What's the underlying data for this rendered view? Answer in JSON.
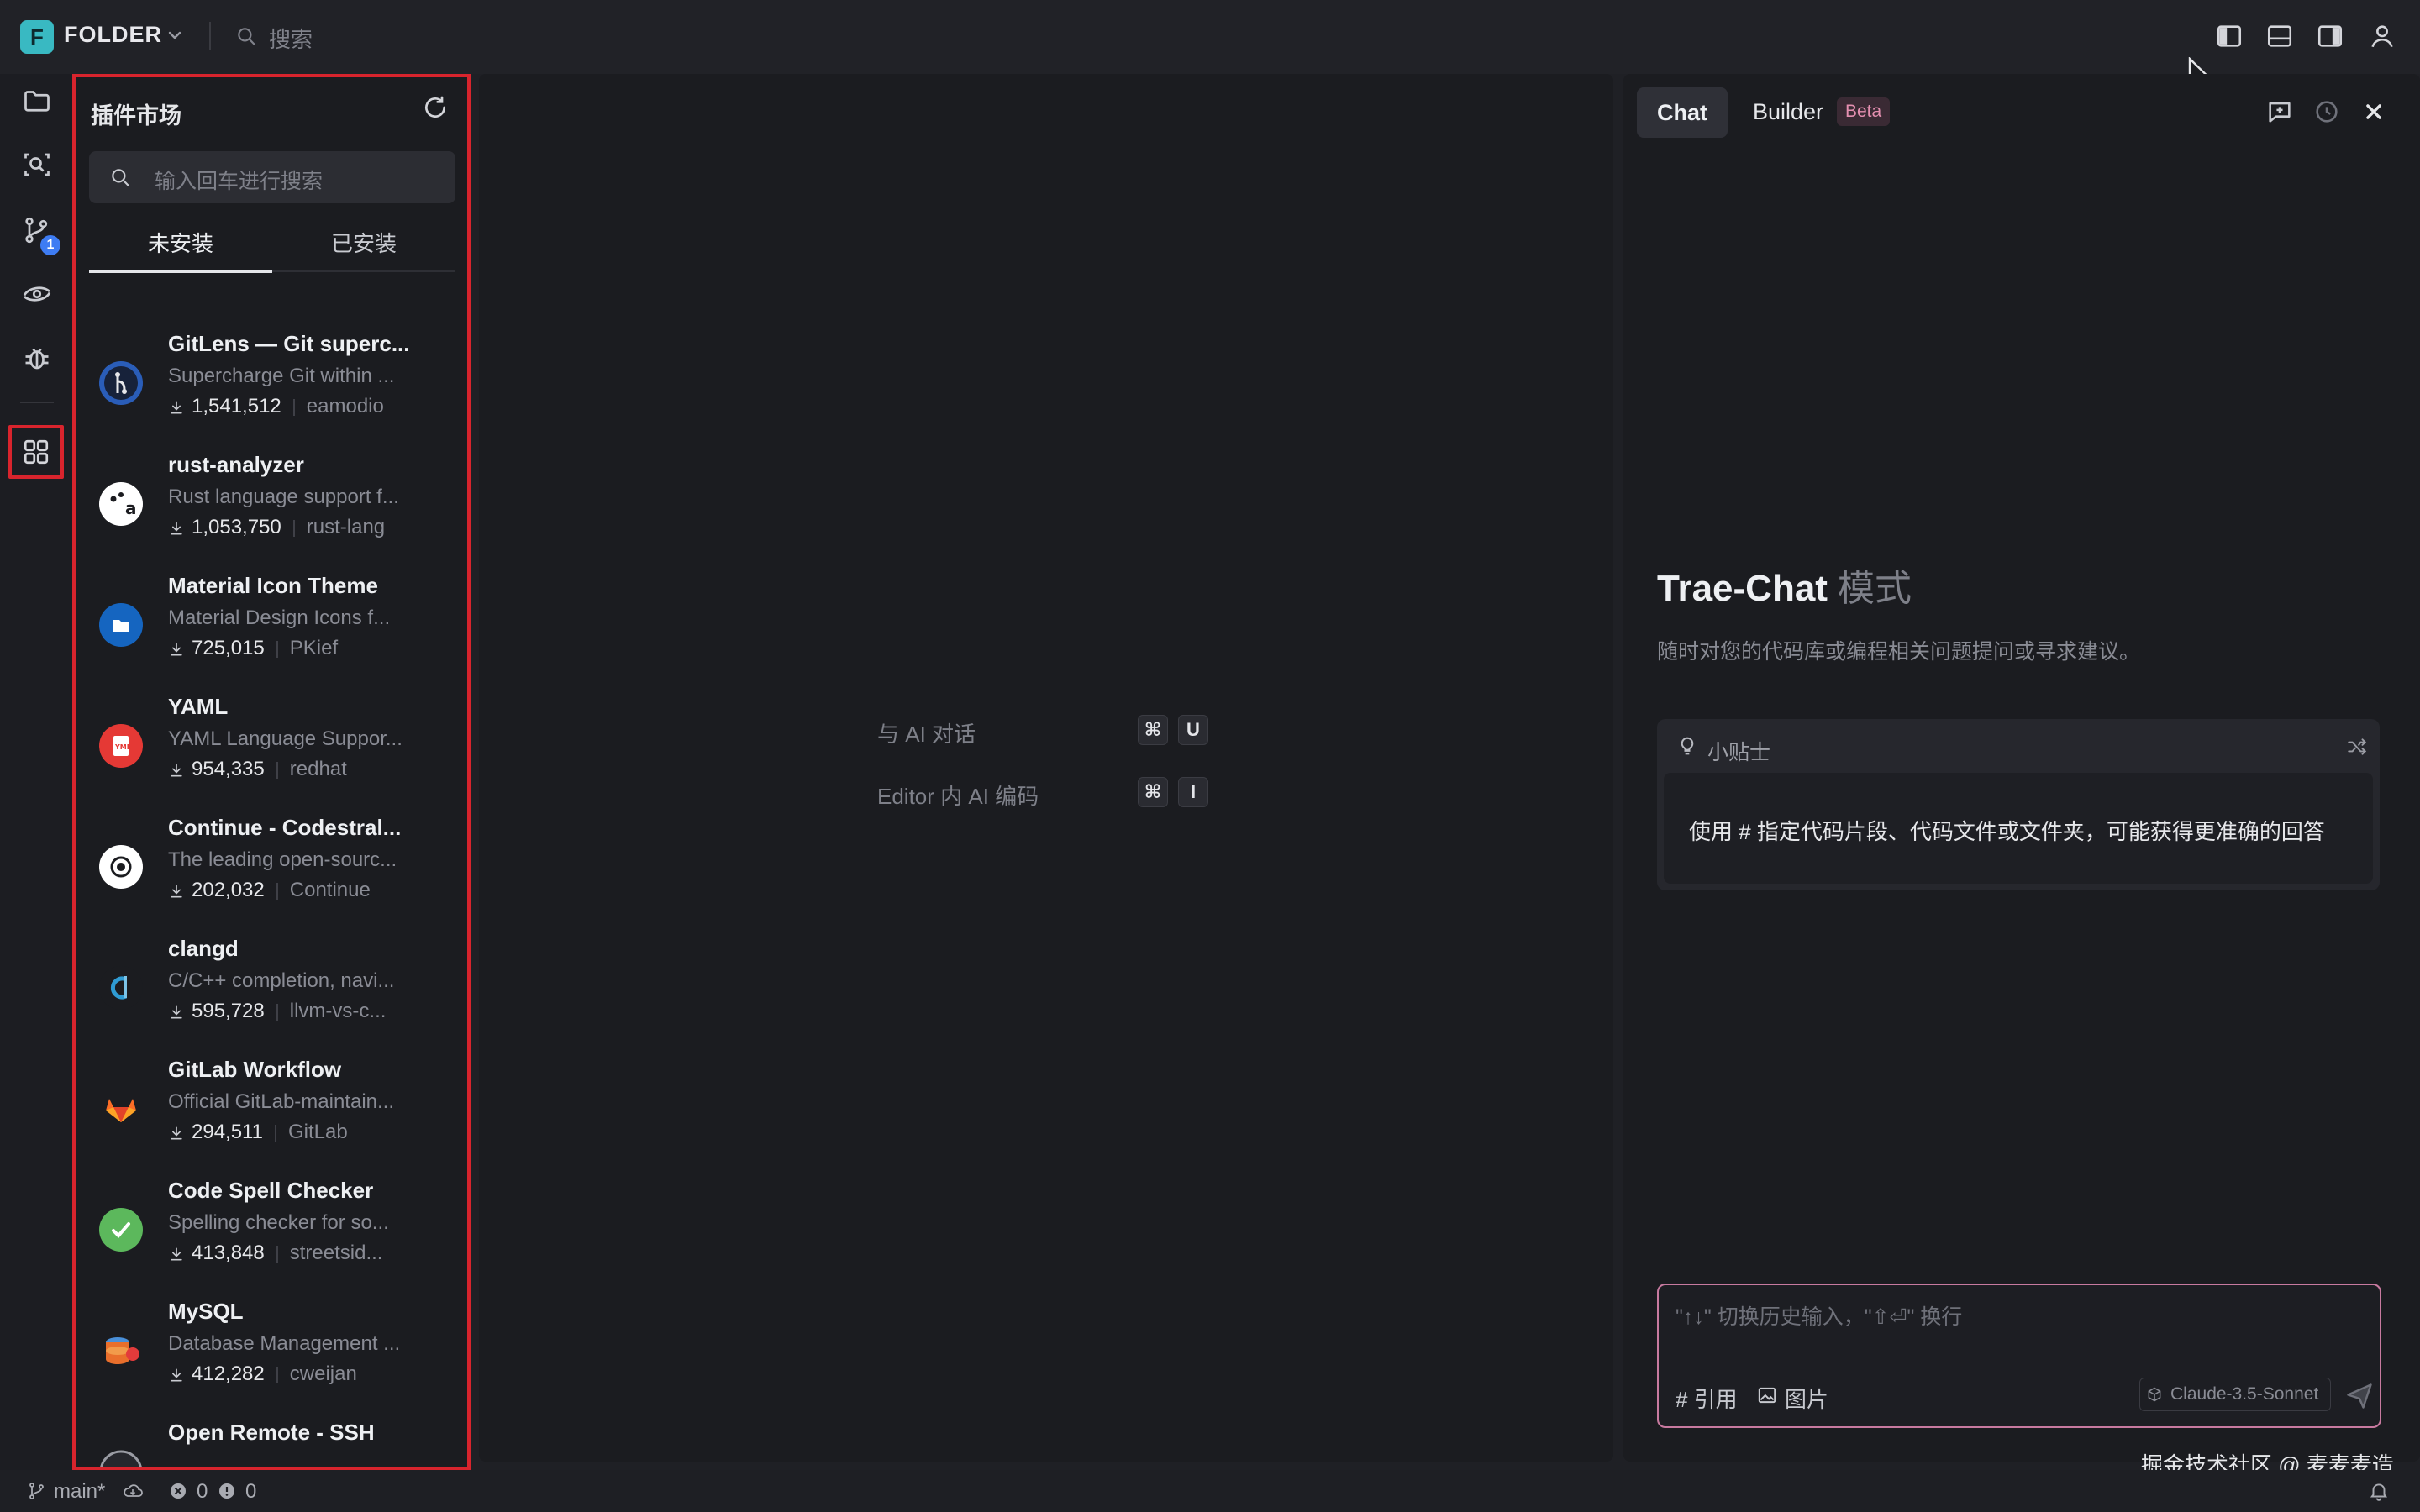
{
  "titlebar": {
    "logo_letter": "F",
    "workspace": "FOLDER",
    "search_placeholder": "搜索"
  },
  "activity": {
    "source_control_badge": "1"
  },
  "extensions": {
    "title": "插件市场",
    "search_placeholder": "输入回车进行搜索",
    "tabs": [
      "未安装",
      "已安装"
    ],
    "items": [
      {
        "name": "GitLens — Git superc...",
        "desc": "Supercharge Git within ...",
        "downloads": "1,541,512",
        "author": "eamodio",
        "icon": "gitlens-icon",
        "color": "#2a5db8"
      },
      {
        "name": "rust-analyzer",
        "desc": "Rust language support f...",
        "downloads": "1,053,750",
        "author": "rust-lang",
        "icon": "rust-analyzer-icon",
        "color": "#ffffff"
      },
      {
        "name": "Material Icon Theme",
        "desc": "Material Design Icons f...",
        "downloads": "725,015",
        "author": "PKief",
        "icon": "material-folder-icon",
        "color": "#1565c0"
      },
      {
        "name": "YAML",
        "desc": "YAML Language Suppor...",
        "downloads": "954,335",
        "author": "redhat",
        "icon": "yaml-icon",
        "color": "#e53935"
      },
      {
        "name": "Continue - Codestral...",
        "desc": "The leading open-sourc...",
        "downloads": "202,032",
        "author": "Continue",
        "icon": "continue-icon",
        "color": "#ffffff"
      },
      {
        "name": "clangd",
        "desc": "C/C++ completion, navi...",
        "downloads": "595,728",
        "author": "llvm-vs-c...",
        "icon": "clangd-icon",
        "color": "#2f9bd3"
      },
      {
        "name": "GitLab Workflow",
        "desc": "Official GitLab-maintain...",
        "downloads": "294,511",
        "author": "GitLab",
        "icon": "gitlab-icon",
        "color": "#fc6d26"
      },
      {
        "name": "Code Spell Checker",
        "desc": "Spelling checker for so...",
        "downloads": "413,848",
        "author": "streetsid...",
        "icon": "spell-check-icon",
        "color": "#5cb85c"
      },
      {
        "name": "MySQL",
        "desc": "Database Management ...",
        "downloads": "412,282",
        "author": "cweijan",
        "icon": "mysql-icon",
        "color": "#e96f2c"
      },
      {
        "name": "Open Remote - SSH",
        "desc": "",
        "downloads": "",
        "author": "",
        "icon": "remote-ssh-icon",
        "color": "#9a9ca4"
      }
    ]
  },
  "editor": {
    "hints": [
      {
        "label": "与 AI 对话",
        "keys": [
          "⌘",
          "U"
        ]
      },
      {
        "label": "Editor 内 AI 编码",
        "keys": [
          "⌘",
          "I"
        ]
      }
    ]
  },
  "chat": {
    "tab_chat": "Chat",
    "tab_builder": "Builder",
    "beta_badge": "Beta",
    "title": "Trae-Chat",
    "title_mode": "模式",
    "subtitle": "随时对您的代码库或编程相关问题提问或寻求建议。",
    "tips_title": "小贴士",
    "tips_text": "使用 # 指定代码片段、代码文件或文件夹，可能获得更准确的回答",
    "input_placeholder": "\"↑↓\" 切换历史输入，\"⇧⏎\" 换行",
    "ref_label": "# 引用",
    "image_label": "图片",
    "model": "Claude-3.5-Sonnet"
  },
  "statusbar": {
    "branch": "main*",
    "errors": "0",
    "warnings": "0",
    "watermark": "掘金技术社区 @ 麦麦麦造"
  }
}
